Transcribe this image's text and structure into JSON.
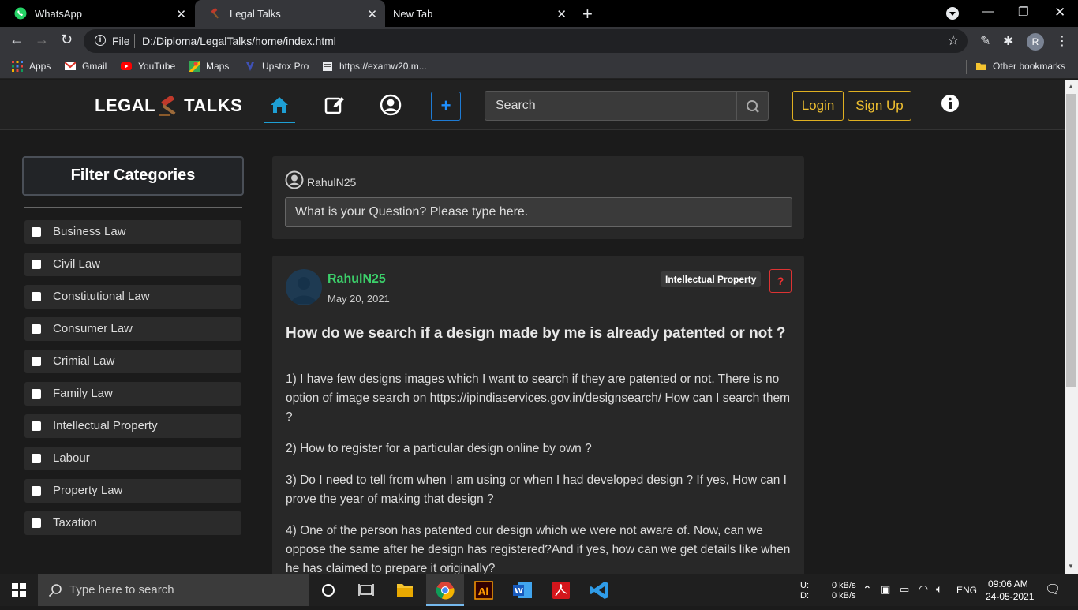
{
  "browser": {
    "tabs": [
      {
        "title": "WhatsApp",
        "active": false
      },
      {
        "title": "Legal Talks",
        "active": true
      },
      {
        "title": "New Tab",
        "active": false
      }
    ],
    "address": {
      "scheme_label": "File",
      "url": "D:/Diploma/LegalTalks/home/index.html"
    },
    "profile_initial": "R",
    "bookmarks": [
      {
        "label": "Apps",
        "icon": "apps-grid-icon"
      },
      {
        "label": "Gmail",
        "icon": "gmail-icon"
      },
      {
        "label": "YouTube",
        "icon": "youtube-icon"
      },
      {
        "label": "Maps",
        "icon": "maps-icon"
      },
      {
        "label": "Upstox Pro",
        "icon": "upstox-icon"
      },
      {
        "label": "https://examw20.m...",
        "icon": "page-icon"
      }
    ],
    "other_bookmarks": "Other bookmarks"
  },
  "site": {
    "logo_left": "LEGAL",
    "logo_right": "TALKS",
    "search_placeholder": "Search",
    "login_label": "Login",
    "signup_label": "Sign Up",
    "accent_color": "#1e9fd4"
  },
  "sidebar": {
    "title": "Filter Categories",
    "categories": [
      "Business Law",
      "Civil Law",
      "Constitutional Law",
      "Consumer Law",
      "Crimial Law",
      "Family Law",
      "Intellectual Property",
      "Labour",
      "Property Law",
      "Taxation"
    ]
  },
  "ask": {
    "username": "RahulN25",
    "placeholder": "What is your Question? Please type here."
  },
  "post": {
    "author": "RahulN25",
    "date": "May 20, 2021",
    "tag": "Intellectual Property",
    "question_mark": "?",
    "title": "How do we search if a design made by me is already patented or not ?",
    "paragraphs": [
      "1) I have few designs images which I want to search if they are patented or not. There is no option of image search on https://ipindiaservices.gov.in/designsearch/ How can I search them ?",
      "2) How to register for a particular design online by own ?",
      "3) Do I need to tell from when I am using or when I had developed design ? If yes, How can I prove the year of making that design ?",
      "4) One of the person has patented our design which we were not aware of. Now, can we oppose the same after he design has registered?And if yes, how can we get details like when he has claimed to prepare it originally?"
    ]
  },
  "taskbar": {
    "search_placeholder": "Type here to search",
    "net_up_label": "U:",
    "net_down_label": "D:",
    "net_up": "0 kB/s",
    "net_down": "0 kB/s",
    "lang": "ENG",
    "time": "09:06 AM",
    "date": "24-05-2021"
  }
}
